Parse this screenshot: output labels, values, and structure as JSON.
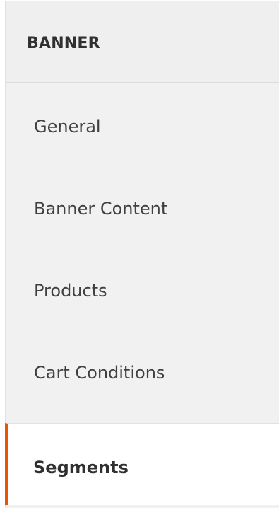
{
  "panel": {
    "title": "BANNER"
  },
  "nav": {
    "items": [
      {
        "label": "General",
        "active": false
      },
      {
        "label": "Banner Content",
        "active": false
      },
      {
        "label": "Products",
        "active": false
      },
      {
        "label": "Cart Conditions",
        "active": false
      },
      {
        "label": "Segments",
        "active": true
      }
    ]
  },
  "colors": {
    "active_indicator": "#eb5202",
    "panel_background": "#f1f1f1",
    "active_background": "#ffffff",
    "text": "#404040"
  }
}
